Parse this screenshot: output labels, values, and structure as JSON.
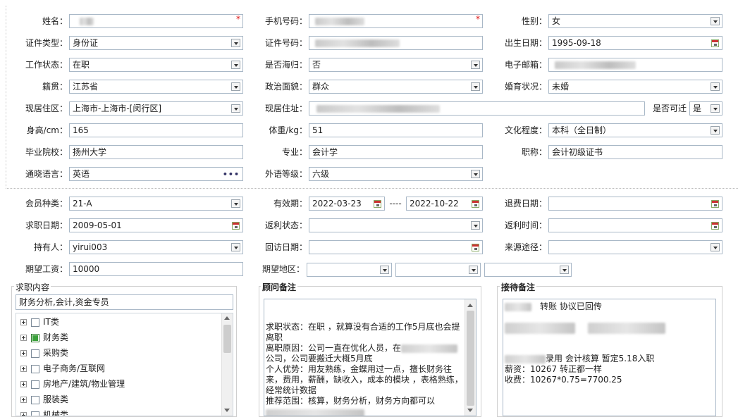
{
  "row1": {
    "name_label": "姓名：",
    "name_value": "",
    "phone_label": "手机号码：",
    "phone_value": "",
    "gender_label": "性别：",
    "gender_value": "女",
    "required_mark": "*"
  },
  "row2": {
    "idtype_label": "证件类型：",
    "idtype_value": "身份证",
    "idno_label": "证件号码：",
    "idno_value": "",
    "birth_label": "出生日期：",
    "birth_value": "1995-09-18"
  },
  "row3": {
    "work_label": "工作状态：",
    "work_value": "在职",
    "returnee_label": "是否海归：",
    "returnee_value": "否",
    "email_label": "电子邮箱：",
    "email_value": ""
  },
  "row4": {
    "native_label": "籍贯：",
    "native_value": "江苏省",
    "political_label": "政治面貌：",
    "political_value": "群众",
    "marital_label": "婚育状况：",
    "marital_value": "未婚"
  },
  "row5": {
    "region_label": "现居住区：",
    "region_value": "上海市-上海市-[闵行区]",
    "address_label": "现居住址：",
    "address_value": "",
    "transfer_label": "是否可迁",
    "transfer_value": "是"
  },
  "row6": {
    "height_label": "身高/cm：",
    "height_value": "165",
    "weight_label": "体重/kg：",
    "weight_value": "51",
    "edu_label": "文化程度：",
    "edu_value": "本科（全日制）"
  },
  "row7": {
    "school_label": "毕业院校：",
    "school_value": "扬州大学",
    "major_label": "专业：",
    "major_value": "会计学",
    "title_label": "职称：",
    "title_value": "会计初级证书"
  },
  "row8": {
    "lang_label": "通晓语言：",
    "lang_value": "英语",
    "langlevel_label": "外语等级：",
    "langlevel_value": "六级"
  },
  "member": {
    "type_label": "会员种类：",
    "type_value": "21-A",
    "valid_label": "有效期：",
    "valid_from": "2022-03-23",
    "valid_sep": "----",
    "valid_to": "2022-10-22",
    "refund_date_label": "退费日期：",
    "refund_date_value": "",
    "apply_label": "求职日期：",
    "apply_value": "2009-05-01",
    "rebate_label": "返利状态：",
    "rebate_value": "",
    "rebate_time_label": "返利时间：",
    "rebate_time_value": "",
    "holder_label": "持有人：",
    "holder_value": "yirui003",
    "visit_label": "回访日期：",
    "visit_value": "",
    "source_label": "来源途径：",
    "source_value": "",
    "salary_label": "期望工资：",
    "salary_value": "10000",
    "area_label": "期望地区："
  },
  "job_panel": {
    "title": "求职内容",
    "selected": "财务分析,会计,资金专员",
    "items": [
      {
        "label": "IT类",
        "checked": false
      },
      {
        "label": "财务类",
        "checked": true
      },
      {
        "label": "采购类",
        "checked": false
      },
      {
        "label": "电子商务/互联网",
        "checked": false
      },
      {
        "label": "房地产/建筑/物业管理",
        "checked": false
      },
      {
        "label": "服装类",
        "checked": false
      },
      {
        "label": "机械类",
        "checked": false
      }
    ]
  },
  "advisor_panel": {
    "title": "顾问备注",
    "line1": "求职状态：在职 ，就算没有合适的工作5月底也会提离职",
    "line2a": "离职原因：公司一直在优化人员，在",
    "line2b": "公司，公司要搬迁大概5月底",
    "line3": "个人优势：用友熟练，金蝶用过一点，擅长财务往来，费用，薪酬，缺收入，成本的模块 ，表格熟练，经常统计数据",
    "line4": "推荐范围：核算，财务分析，财务方向都可以"
  },
  "reception_panel": {
    "title": "接待备注",
    "line1": "转账 协议已回传",
    "line3": "录用  会计核算  暂定5.18入职",
    "line4": "薪资：10267  转正都一样",
    "line5": "收费：10267*0.75=7700.25"
  }
}
